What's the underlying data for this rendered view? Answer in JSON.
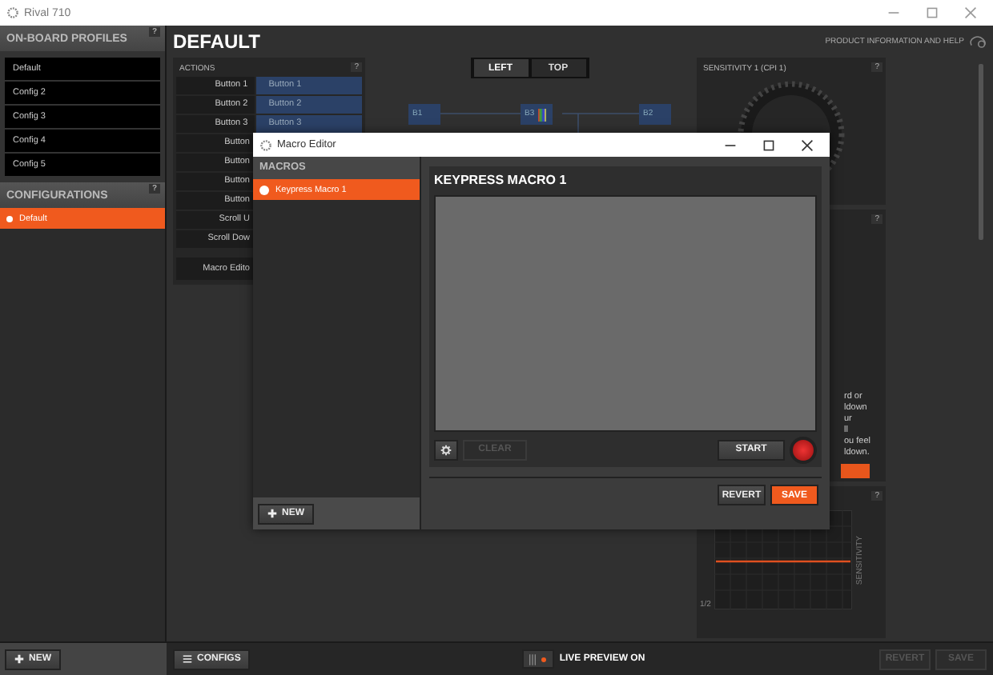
{
  "window": {
    "title": "Rival 710"
  },
  "sidebar": {
    "profiles_header": "ON-BOARD PROFILES",
    "profiles_help": "?",
    "profiles": [
      "Default",
      "Config 2",
      "Config 3",
      "Config 4",
      "Config 5"
    ],
    "configs_header": "CONFIGURATIONS",
    "configs_help": "?",
    "configs": [
      {
        "label": "Default",
        "selected": true
      }
    ],
    "new_button": "NEW"
  },
  "page": {
    "title": "DEFAULT",
    "help_link": "PRODUCT INFORMATION AND HELP"
  },
  "actions": {
    "title": "ACTIONS",
    "help": "?",
    "rows": [
      {
        "label": "Button 1",
        "assigned": "Button 1"
      },
      {
        "label": "Button 2",
        "assigned": "Button 2"
      },
      {
        "label": "Button 3",
        "assigned": "Button 3"
      },
      {
        "label": "Button"
      },
      {
        "label": "Button"
      },
      {
        "label": "Button"
      },
      {
        "label": "Button"
      },
      {
        "label": "Scroll U"
      },
      {
        "label": "Scroll Dow"
      }
    ],
    "macro_editor": "Macro Edito"
  },
  "view_tabs": [
    {
      "label": "LEFT",
      "selected": true
    },
    {
      "label": "TOP",
      "selected": false
    }
  ],
  "diagram": {
    "nodes": [
      {
        "label": "B1",
        "kind": "plain"
      },
      {
        "label": "B3",
        "kind": "color"
      },
      {
        "label": "B2",
        "kind": "plain"
      }
    ]
  },
  "sensitivity": {
    "title": "SENSITIVITY 1 (CPI 1)",
    "help": "?"
  },
  "panel_2": {
    "help": "?",
    "text_lines": [
      "rd or",
      "ldown",
      "ur",
      "ll",
      "ou feel",
      "ldown."
    ]
  },
  "panel_3": {
    "help": "?",
    "axis_label": "SENSITIVITY",
    "corner_label": "1/2"
  },
  "dialog": {
    "title": "Macro Editor",
    "list_header": "MACROS",
    "macros": [
      {
        "label": "Keypress Macro 1",
        "selected": true
      }
    ],
    "new_button": "NEW",
    "macro_title": "KEYPRESS MACRO 1",
    "clear_button": {
      "label": "CLEAR",
      "disabled": true
    },
    "start_button": "START",
    "revert_button": "REVERT",
    "save_button": "SAVE"
  },
  "bottom_bar": {
    "configs_button": "CONFIGS",
    "live_preview": {
      "label": "LIVE PREVIEW ON",
      "on": true
    },
    "revert_button": {
      "label": "REVERT",
      "disabled": true
    },
    "save_button": {
      "label": "SAVE",
      "disabled": true
    }
  }
}
